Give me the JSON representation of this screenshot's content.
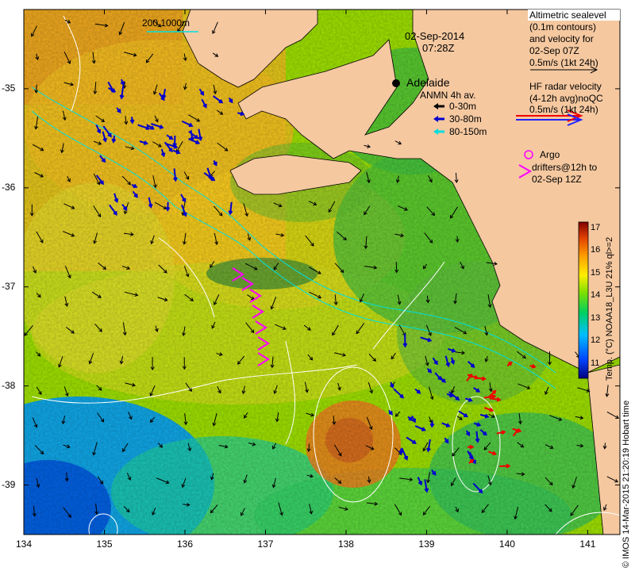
{
  "title": {
    "date": "02-Sep-2014",
    "time": "07:28Z"
  },
  "scale_bar": {
    "label": "200  1000m"
  },
  "place": {
    "name": "Adelaide"
  },
  "legend_sealevel": {
    "lines": [
      "Altimetric sealevel",
      "(0.1m contours)",
      "and velocity for",
      "02-Sep 07Z",
      "0.5m/s (1kt 24h)"
    ]
  },
  "legend_hf": {
    "lines": [
      "HF radar velocity",
      "(4-12h avg)noQC",
      "0.5m/s (1kt 24h)"
    ]
  },
  "legend_anmn": {
    "title": "ANMN 4h av.",
    "items": [
      {
        "label": "0-30m",
        "color": "#000000"
      },
      {
        "label": "30-80m",
        "color": "#0000cc"
      },
      {
        "label": "80-150m",
        "color": "#00dddd"
      }
    ]
  },
  "legend_argo": {
    "line1": "Argo",
    "line2": "drifters@12h to",
    "line3": "02-Sep 12Z",
    "color": "#ff00ff"
  },
  "colorbar": {
    "ticks": [
      "17",
      "16",
      "15",
      "14",
      "13",
      "12",
      "11"
    ],
    "label": "Temp. (°C) NOAA18_L3U 21% ql>=2",
    "min": 10.4,
    "max": 17.3
  },
  "credit": "© IMOS 14-Mar-2015 21:20:19 Hobart time",
  "axes": {
    "x_ticks": [
      "134",
      "135",
      "136",
      "137",
      "138",
      "139",
      "140",
      "141"
    ],
    "y_ticks": [
      "-35",
      "-36",
      "-37",
      "-38",
      "-39"
    ],
    "x_range": [
      134,
      141.4
    ],
    "y_range": [
      -39.5,
      -34.2
    ]
  },
  "colors": {
    "land": "#f5c8a0",
    "hf_red": "#ee0000",
    "hf_blue": "#2222ff",
    "anmn_blue": "#0000cc",
    "argo": "#ff00ff"
  }
}
